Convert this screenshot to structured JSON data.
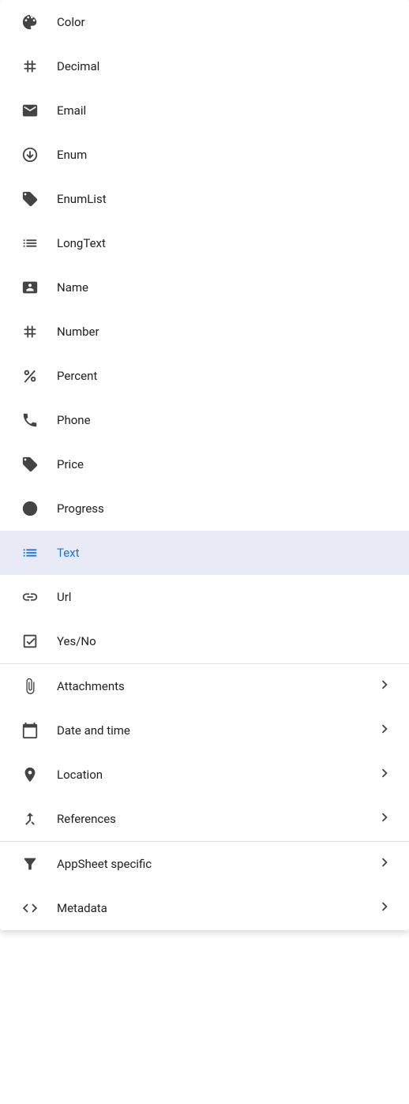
{
  "menu": {
    "sections": [
      {
        "id": "basic",
        "items": [
          {
            "id": "color",
            "label": "Color",
            "icon": "palette",
            "selected": false,
            "has_arrow": false
          },
          {
            "id": "decimal",
            "label": "Decimal",
            "icon": "hash",
            "selected": false,
            "has_arrow": false
          },
          {
            "id": "email",
            "label": "Email",
            "icon": "envelope",
            "selected": false,
            "has_arrow": false
          },
          {
            "id": "enum",
            "label": "Enum",
            "icon": "circle-down",
            "selected": false,
            "has_arrow": false
          },
          {
            "id": "enumlist",
            "label": "EnumList",
            "icon": "tag-outline",
            "selected": false,
            "has_arrow": false
          },
          {
            "id": "longtext",
            "label": "LongText",
            "icon": "list-text",
            "selected": false,
            "has_arrow": false
          },
          {
            "id": "name",
            "label": "Name",
            "icon": "id-card",
            "selected": false,
            "has_arrow": false
          },
          {
            "id": "number",
            "label": "Number",
            "icon": "hash",
            "selected": false,
            "has_arrow": false
          },
          {
            "id": "percent",
            "label": "Percent",
            "icon": "percent",
            "selected": false,
            "has_arrow": false
          },
          {
            "id": "phone",
            "label": "Phone",
            "icon": "phone",
            "selected": false,
            "has_arrow": false
          },
          {
            "id": "price",
            "label": "Price",
            "icon": "price-tag",
            "selected": false,
            "has_arrow": false
          },
          {
            "id": "progress",
            "label": "Progress",
            "icon": "circle-fill",
            "selected": false,
            "has_arrow": false
          },
          {
            "id": "text",
            "label": "Text",
            "icon": "lines",
            "selected": true,
            "has_arrow": false
          },
          {
            "id": "url",
            "label": "Url",
            "icon": "link",
            "selected": false,
            "has_arrow": false
          },
          {
            "id": "yesno",
            "label": "Yes/No",
            "icon": "checkbox",
            "selected": false,
            "has_arrow": false
          }
        ]
      },
      {
        "id": "special",
        "items": [
          {
            "id": "attachments",
            "label": "Attachments",
            "icon": "paperclip",
            "selected": false,
            "has_arrow": true
          },
          {
            "id": "date-and-time",
            "label": "Date and time",
            "icon": "calendar",
            "selected": false,
            "has_arrow": true
          },
          {
            "id": "location",
            "label": "Location",
            "icon": "pin",
            "selected": false,
            "has_arrow": true
          },
          {
            "id": "references",
            "label": "References",
            "icon": "merge",
            "selected": false,
            "has_arrow": true
          }
        ]
      },
      {
        "id": "advanced",
        "items": [
          {
            "id": "appsheet-specific",
            "label": "AppSheet specific",
            "icon": "funnel",
            "selected": false,
            "has_arrow": true
          },
          {
            "id": "metadata",
            "label": "Metadata",
            "icon": "code",
            "selected": false,
            "has_arrow": true
          }
        ]
      }
    ]
  }
}
